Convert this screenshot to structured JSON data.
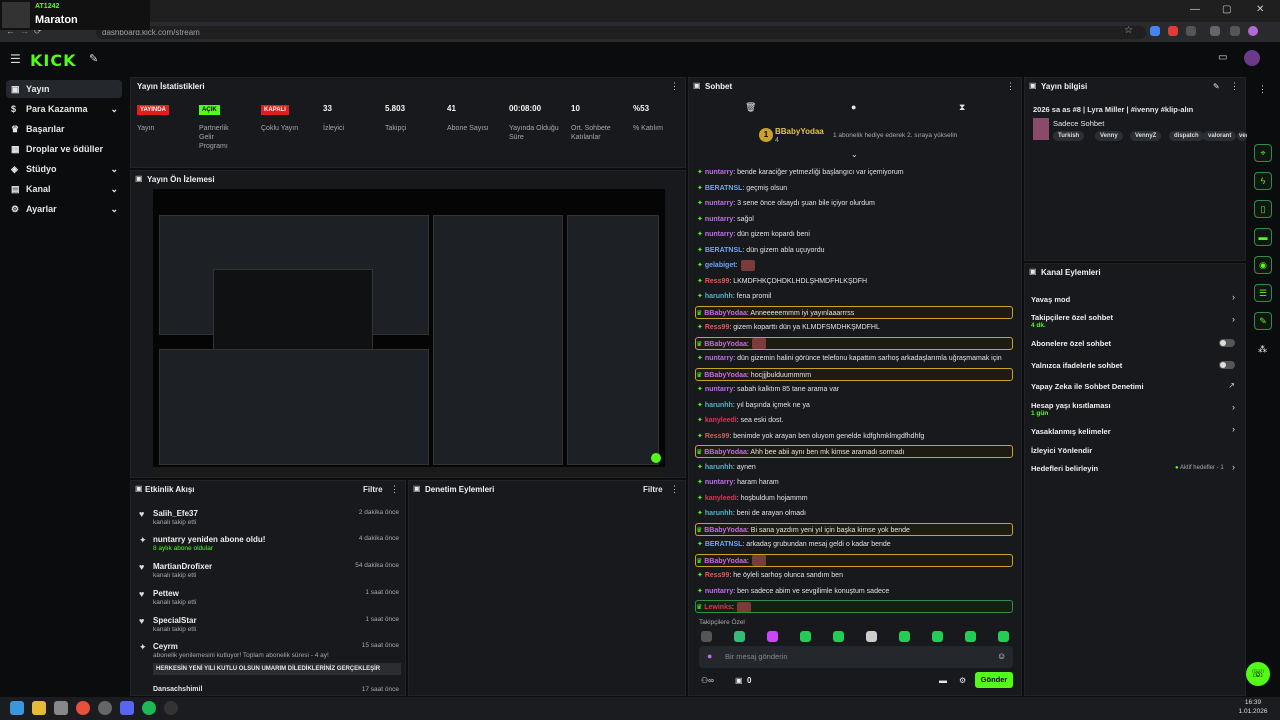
{
  "browser": {
    "url": "dashboard.kick.com/stream"
  },
  "overlay": {
    "handle": "AT1242",
    "title": "Maraton"
  },
  "header": {
    "logo": "KICK"
  },
  "sidebar": {
    "items": [
      {
        "label": "Yayın",
        "icon": "broadcast-icon"
      },
      {
        "label": "Para Kazanma",
        "icon": "dollar-icon"
      },
      {
        "label": "Başarılar",
        "icon": "trophy-icon"
      },
      {
        "label": "Droplar ve ödüller",
        "icon": "gift-icon"
      },
      {
        "label": "Stüdyo",
        "icon": "studio-icon"
      },
      {
        "label": "Kanal",
        "icon": "channel-icon"
      },
      {
        "label": "Ayarlar",
        "icon": "gear-icon"
      }
    ]
  },
  "stats": {
    "title": "Yayın İstatistikleri",
    "items": [
      {
        "value": "YAYINDA",
        "label": "Yayın"
      },
      {
        "value": "AÇIK",
        "label": "Partnerlik Gelir Programı"
      },
      {
        "value": "KAPALI",
        "label": "Çoklu Yayın"
      },
      {
        "value": "33",
        "label": "İzleyici"
      },
      {
        "value": "5.803",
        "label": "Takipçi"
      },
      {
        "value": "41",
        "label": "Abone Sayısı"
      },
      {
        "value": "00:08:00",
        "label": "Yayında Olduğu Süre"
      },
      {
        "value": "10",
        "label": "Ort. Sohbete Katılanlar"
      },
      {
        "value": "%53",
        "label": "% Katılım"
      }
    ]
  },
  "preview": {
    "title": "Yayın Ön İzlemesi"
  },
  "activity": {
    "title": "Etkinlik Akışı",
    "filter": "Filtre",
    "items": [
      {
        "name": "Salih_Efe37",
        "sub": "kanalı takip etti",
        "time": "2 dakika önce"
      },
      {
        "name": "nuntarry yeniden abone oldu!",
        "sub": "8 aylık abone oldular",
        "time": "4 dakika önce"
      },
      {
        "name": "MartianDrofixer",
        "sub": "kanalı takip etti",
        "time": "54 dakika önce"
      },
      {
        "name": "Pettew",
        "sub": "kanalı takip etti",
        "time": "1 saat önce"
      },
      {
        "name": "SpecialStar",
        "sub": "kanalı takip etti",
        "time": "1 saat önce"
      },
      {
        "name": "Ceyrm",
        "sub": "abonelik yenilemesini kutluyor! Toplam abonelik süresi - 4 ay!",
        "time": "15 saat önce"
      }
    ],
    "quote": "HERKESİN YENİ YILI KUTLU OLSUN UMARIM DİLEDİKLERİNİZ GERÇEKLEŞİR",
    "last_name": "Dansachshimil",
    "last_time": "17 saat önce"
  },
  "moderation": {
    "title": "Denetim Eylemleri",
    "filter": "Filtre"
  },
  "chat": {
    "title": "Sohbet",
    "pinned_user": "BBabyYodaa",
    "pinned_count": "4",
    "pinned_text": "1 abonelik hediye ederek 2. sıraya yükselin",
    "messages": [
      {
        "user": "nuntarry",
        "color": "#c16de8",
        "text": ": bende karaciğer yetmezliği başlangıcı var içemiyorum",
        "hl": ""
      },
      {
        "user": "BERATNSL",
        "color": "#6ba3ff",
        "text": ": geçmiş olsun",
        "hl": ""
      },
      {
        "user": "nuntarry",
        "color": "#c16de8",
        "text": ": 3 sene önce olsaydı şuan bile içiyor olurdum",
        "hl": ""
      },
      {
        "user": "nuntarry",
        "color": "#c16de8",
        "text": ": sağol",
        "hl": ""
      },
      {
        "user": "nuntarry",
        "color": "#c16de8",
        "text": ": dün gizem kopardı beni",
        "hl": ""
      },
      {
        "user": "BERATNSL",
        "color": "#6ba3ff",
        "text": ": dün gizem abla uçuyordu",
        "hl": ""
      },
      {
        "user": "gelabiget",
        "color": "#6ba3ff",
        "text": ":",
        "hl": "",
        "emote": true
      },
      {
        "user": "Ress99",
        "color": "#e05b5b",
        "text": ": LKMDFHKÇDHDKLHDLŞHMDFHLKŞDFH",
        "hl": ""
      },
      {
        "user": "harunhh",
        "color": "#4fb3c9",
        "text": ": fena promil",
        "hl": ""
      },
      {
        "user": "BBabyYodaa",
        "color": "#c16de8",
        "text": ": Anneeeeemmm iyi yayınlaaarrrss",
        "hl": "gold"
      },
      {
        "user": "Ress99",
        "color": "#e05b5b",
        "text": ": gizem koparttı dün ya KLMDFSMDHKŞMDFHL",
        "hl": ""
      },
      {
        "user": "BBabyYodaa",
        "color": "#c16de8",
        "text": ":",
        "hl": "gold",
        "emote": true
      },
      {
        "user": "nuntarry",
        "color": "#c16de8",
        "text": ": dün gizemin halini görünce telefonu kapattım sarhoş arkadaşlarımla uğraşmamak için",
        "hl": ""
      },
      {
        "user": "BBabyYodaa",
        "color": "#c16de8",
        "text": ": hocjjjbulduummmm",
        "hl": "gold"
      },
      {
        "user": "nuntarry",
        "color": "#c16de8",
        "text": ": sabah kalktım 85 tane arama var",
        "hl": ""
      },
      {
        "user": "harunhh",
        "color": "#4fb3c9",
        "text": ": yıl başında içmek ne ya",
        "hl": ""
      },
      {
        "user": "kanyleedi",
        "color": "#e0305b",
        "text": ": sea eski dost.",
        "hl": ""
      },
      {
        "user": "Ress99",
        "color": "#e05b5b",
        "text": ": benimde yok arayan ben oluyom genelde kdfghmklmgdfhdhfg",
        "hl": ""
      },
      {
        "user": "BBabyYodaa",
        "color": "#c16de8",
        "text": ": Ahh bee abii aynı ben mk kimse aramadı sormadı",
        "hl": "gold"
      },
      {
        "user": "harunhh",
        "color": "#4fb3c9",
        "text": ": aynen",
        "hl": ""
      },
      {
        "user": "nuntarry",
        "color": "#c16de8",
        "text": ": haram haram",
        "hl": ""
      },
      {
        "user": "kanyleedi",
        "color": "#e0305b",
        "text": ": hoşbuldum hojammm",
        "hl": ""
      },
      {
        "user": "harunhh",
        "color": "#4fb3c9",
        "text": ": beni de arayan olmadı",
        "hl": ""
      },
      {
        "user": "BBabyYodaa",
        "color": "#c16de8",
        "text": ": Bi sana yazdım yeni yıl için başka kimse yok bende",
        "hl": "gold"
      },
      {
        "user": "BERATNSL",
        "color": "#6ba3ff",
        "text": ": arkadaş grubundan mesaj geldi o kadar bende",
        "hl": ""
      },
      {
        "user": "BBabyYodaa",
        "color": "#c16de8",
        "text": ":",
        "hl": "gold",
        "emote": true
      },
      {
        "user": "Ress99",
        "color": "#e05b5b",
        "text": ": he öyleli sarhoş olunca sandım ben",
        "hl": ""
      },
      {
        "user": "nuntarry",
        "color": "#c16de8",
        "text": ": ben sadece abim ve sevgilimle konuştum sadece",
        "hl": ""
      },
      {
        "user": "Lewinks",
        "color": "#e0305b",
        "text": ":",
        "hl": "green",
        "emote": true
      }
    ],
    "followers_only": "Takipçilere Özel",
    "input_placeholder": "Bir mesaj gönderin",
    "points": "0",
    "send_label": "Gönder"
  },
  "stream_info": {
    "title": "Yayın bilgisi",
    "stream_title": "2026 sa as #8 | Lyra Miller | #ivenny #klip-alın",
    "category": "Sadece Sohbet",
    "tags": [
      "Turkish",
      "Venny",
      "VennyZ",
      "dispatch",
      "valorant",
      "ven"
    ]
  },
  "channel_actions": {
    "title": "Kanal Eylemleri",
    "items": [
      {
        "label": "Yavaş mod",
        "sub": "",
        "control": "arrow"
      },
      {
        "label": "Takipçilere özel sohbet",
        "sub": "4 dk.",
        "control": "arrow"
      },
      {
        "label": "Abonelere özel sohbet",
        "sub": "",
        "control": "toggle"
      },
      {
        "label": "Yalnızca ifadelerle sohbet",
        "sub": "",
        "control": "toggle"
      },
      {
        "label": "Yapay Zeka ile Sohbet Denetimi",
        "sub": "",
        "control": "ext"
      },
      {
        "label": "Hesap yaşı kısıtlaması",
        "sub": "1 gün",
        "control": "arrow"
      },
      {
        "label": "Yasaklanmış kelimeler",
        "sub": "",
        "control": "arrow"
      },
      {
        "label": "İzleyici Yönlendir",
        "sub": "",
        "control": ""
      },
      {
        "label": "Hedefleri belirleyin",
        "sub": "",
        "control": "arrow",
        "extra": "Aktif hedefler - 1"
      }
    ]
  },
  "taskbar": {
    "time": "16:39",
    "date": "1.01.2026"
  }
}
